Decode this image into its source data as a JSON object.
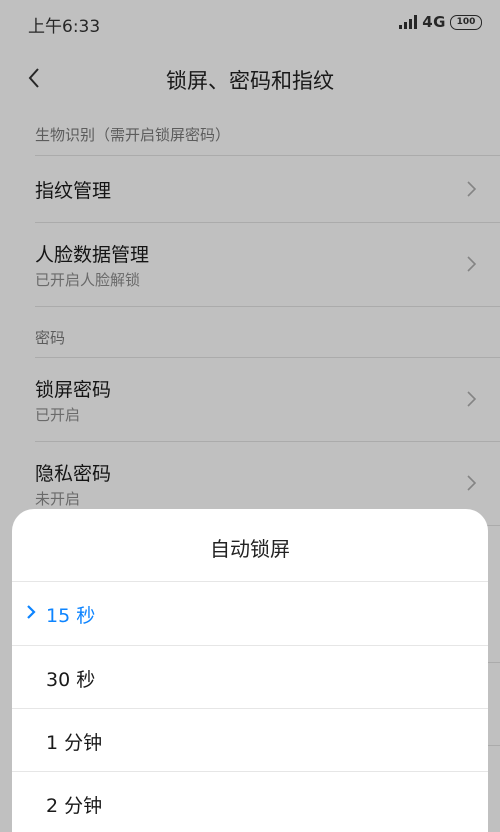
{
  "status_bar": {
    "time": "上午6:33",
    "network": "4G",
    "battery": "100"
  },
  "header": {
    "title": "锁屏、密码和指纹"
  },
  "sections": {
    "biometrics": {
      "header": "生物识别（需开启锁屏密码）",
      "fingerprint": {
        "title": "指纹管理"
      },
      "face": {
        "title": "人脸数据管理",
        "subtitle": "已开启人脸解锁"
      }
    },
    "password": {
      "header": "密码",
      "lock_password": {
        "title": "锁屏密码",
        "subtitle": "已开启"
      },
      "privacy_password": {
        "title": "隐私密码",
        "subtitle": "未开启"
      }
    }
  },
  "sheet": {
    "title": "自动锁屏",
    "options": [
      {
        "label": "15 秒",
        "selected": true
      },
      {
        "label": "30 秒",
        "selected": false
      },
      {
        "label": "1 分钟",
        "selected": false
      },
      {
        "label": "2 分钟",
        "selected": false
      }
    ],
    "accent_color": "#0d84ff"
  }
}
